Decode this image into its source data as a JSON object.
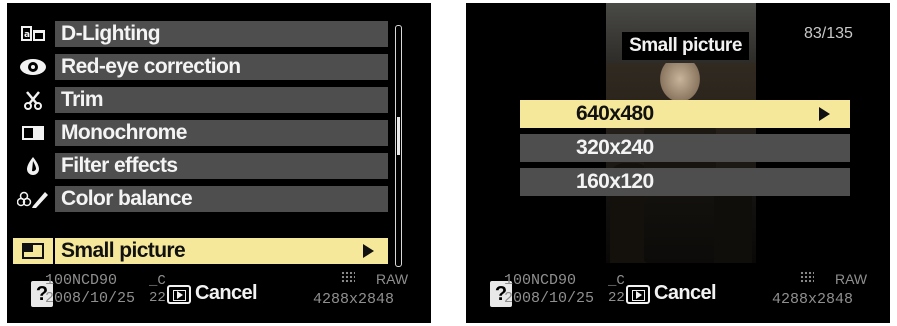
{
  "left_screen": {
    "menu_items": [
      {
        "label": "D-Lighting",
        "icon": "d-lighting-icon"
      },
      {
        "label": "Red-eye correction",
        "icon": "eye-icon"
      },
      {
        "label": "Trim",
        "icon": "scissors-icon"
      },
      {
        "label": "Monochrome",
        "icon": "monochrome-icon"
      },
      {
        "label": "Filter effects",
        "icon": "filter-drop-icon"
      },
      {
        "label": "Color balance",
        "icon": "color-balance-icon"
      },
      {
        "label": "Small picture",
        "icon": "small-picture-icon",
        "selected": true
      }
    ],
    "scrollbar": {
      "position_fraction": 0.45
    }
  },
  "right_screen": {
    "title": "Small picture",
    "counter": "83/135",
    "options": [
      {
        "label": "640x480",
        "selected": true
      },
      {
        "label": "320x240"
      },
      {
        "label": "160x120"
      }
    ]
  },
  "footer": {
    "help": "?",
    "folder": "100NCD90",
    "date": "2008/10/25",
    "marks_top": "_C",
    "marks_bottom": "22",
    "cancel_label": "Cancel",
    "quality": "RAW",
    "image_size": "4288x2848"
  },
  "colors": {
    "menu_bg": "#4e4e4e",
    "selected_bg": "#f6e89a",
    "screen_bg": "#000000",
    "footer_text": "#8f8f8f"
  }
}
